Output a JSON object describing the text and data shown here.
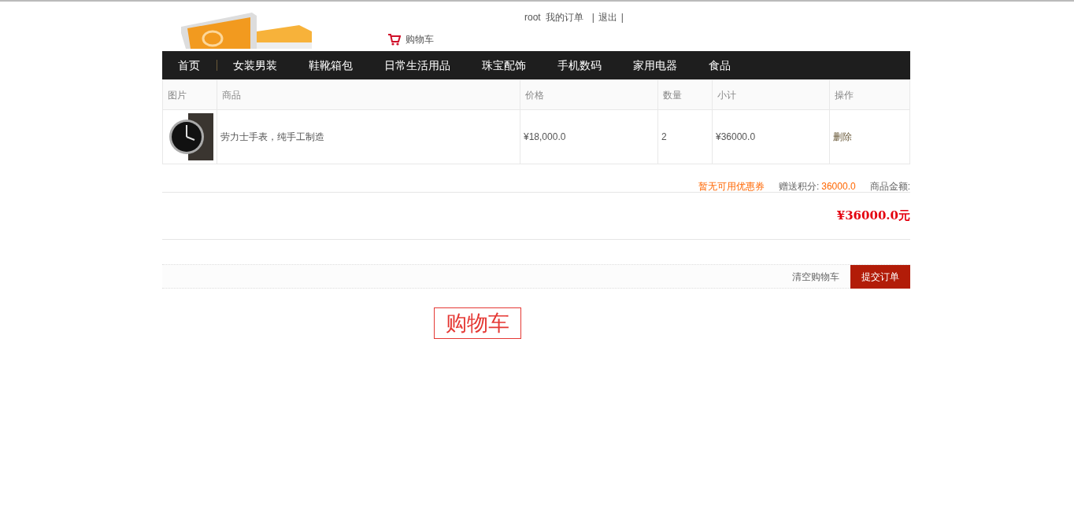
{
  "header": {
    "user": "root",
    "links": [
      {
        "label": "我的订单"
      },
      {
        "label": "退出"
      }
    ],
    "separator": "|",
    "cart_link": "购物车"
  },
  "nav": {
    "items": [
      {
        "label": "首页",
        "selected": false
      },
      {
        "label": "女装男装",
        "selected": false
      },
      {
        "label": "鞋靴箱包",
        "selected": false
      },
      {
        "label": "日常生活用品",
        "selected": false
      },
      {
        "label": "珠宝配饰",
        "selected": false
      },
      {
        "label": "手机数码",
        "selected": false
      },
      {
        "label": "家用电器",
        "selected": false
      },
      {
        "label": "食品",
        "selected": false
      }
    ]
  },
  "cart_table": {
    "columns": [
      "图片",
      "商品",
      "价格",
      "数量",
      "小计",
      "操作"
    ],
    "rows": [
      {
        "product": "劳力士手表，纯手工制造",
        "price": "¥18,000.0",
        "quantity": "2",
        "subtotal": "¥36000.0",
        "action": "删除"
      }
    ]
  },
  "summary": {
    "coupon": "暂无可用优惠券",
    "points_label": "赠送积分:",
    "points": "36000.0",
    "amount_label": "商品金额:",
    "total": "¥36000.0元"
  },
  "actions": {
    "clear": "清空购物车",
    "submit": "提交订单"
  },
  "stamp": "购物车"
}
